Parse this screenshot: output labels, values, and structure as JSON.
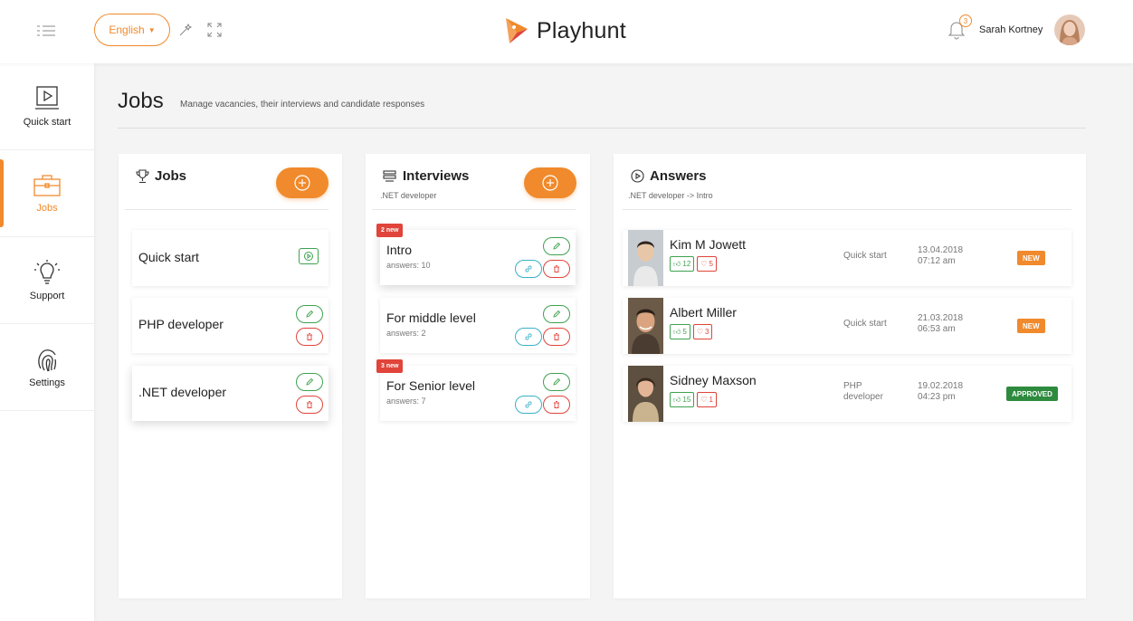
{
  "header": {
    "language": "English",
    "brand": "Playhunt",
    "notifications_count": "3",
    "user_name": "Sarah Kortney"
  },
  "sidebar": {
    "items": [
      {
        "label": "Quick start",
        "icon": "play-screen-icon"
      },
      {
        "label": "Jobs",
        "icon": "briefcase-icon",
        "active": true
      },
      {
        "label": "Support",
        "icon": "lightbulb-icon"
      },
      {
        "label": "Settings",
        "icon": "fingerprint-icon"
      }
    ]
  },
  "page": {
    "title": "Jobs",
    "subtitle": "Manage vacancies, their interviews and candidate responses"
  },
  "jobs_panel": {
    "title": "Jobs",
    "items": [
      {
        "name": "Quick start"
      },
      {
        "name": "PHP developer"
      },
      {
        "name": ".NET developer",
        "selected": true
      }
    ]
  },
  "interviews_panel": {
    "title": "Interviews",
    "subtitle": ".NET developer",
    "items": [
      {
        "name": "Intro",
        "answers": "answers: 10",
        "badge": "2 new",
        "selected": true
      },
      {
        "name": "For middle level",
        "answers": "answers: 2",
        "badge": ""
      },
      {
        "name": "For Senior level",
        "answers": "answers: 7",
        "badge": "3 new"
      }
    ]
  },
  "answers_panel": {
    "title": "Answers",
    "subtitle": ".NET developer -> Intro",
    "items": [
      {
        "name": "Kim M Jowett",
        "likes": "12",
        "dislikes": "5",
        "job": "Quick start",
        "date": "13.04.2018",
        "time": "07:12 am",
        "status": "NEW"
      },
      {
        "name": "Albert Miller",
        "likes": "5",
        "dislikes": "3",
        "job": "Quick start",
        "date": "21.03.2018",
        "time": "06:53 am",
        "status": "NEW"
      },
      {
        "name": "Sidney Maxson",
        "likes": "15",
        "dislikes": "1",
        "job": "PHP developer",
        "date": "19.02.2018",
        "time": "04:23 pm",
        "status": "APPROVED"
      }
    ]
  },
  "colors": {
    "accent": "#f08a2c",
    "approved": "#2e8b3e",
    "danger": "#e0443a",
    "link": "#3ab0c8"
  }
}
